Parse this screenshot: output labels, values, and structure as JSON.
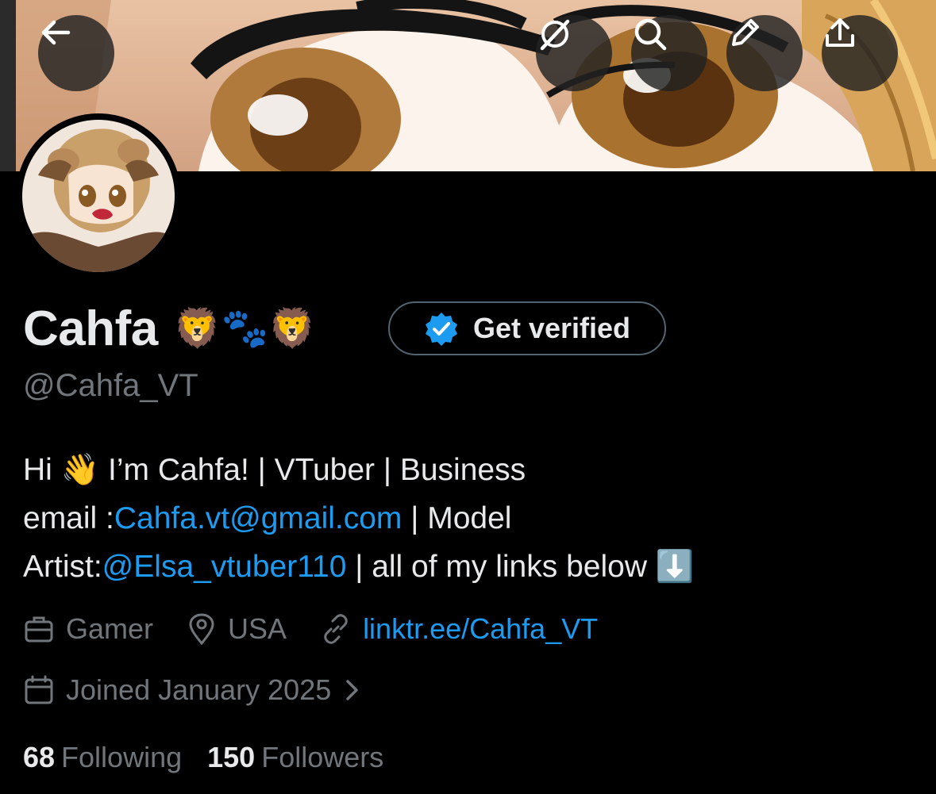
{
  "header": {
    "back_icon": "arrow-left-icon",
    "grok_icon": "grok-slash-icon",
    "search_icon": "search-icon",
    "edit_icon": "pencil-icon",
    "share_icon": "share-upload-icon"
  },
  "profile": {
    "display_name": "Cahfa",
    "name_emoji": "🦁🐾🦁",
    "get_verified_label": "Get verified",
    "handle": "@Cahfa_VT",
    "bio": {
      "line1": "Hi 👋 I’m Cahfa! | VTuber | Business",
      "line2_prefix": "email :",
      "line2_link": "Cahfa.vt@gmail.com",
      "line2_suffix": " | Model",
      "line3_prefix": "Artist:",
      "line3_link": "@Elsa_vtuber110",
      "line3_suffix": " | all of my links below ⬇️"
    },
    "category": "Gamer",
    "location": "USA",
    "website": "linktr.ee/Cahfa_VT",
    "joined": "Joined January 2025"
  },
  "stats": {
    "following_count": "68",
    "following_label": "Following",
    "followers_count": "150",
    "followers_label": "Followers"
  },
  "colors": {
    "background": "#000000",
    "text": "#e7e9ea",
    "muted": "#71767b",
    "link": "#1d9bf0",
    "verified_badge": "#1d9bf0"
  }
}
